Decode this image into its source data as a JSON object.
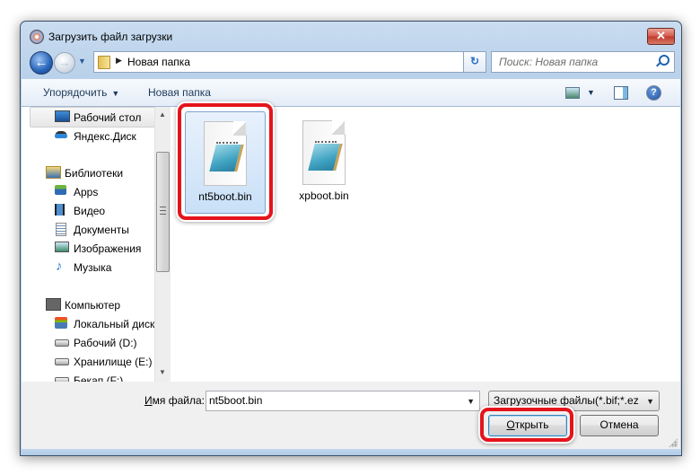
{
  "window": {
    "title": "Загрузить файл загрузки",
    "close_label": "✕"
  },
  "navigation": {
    "back_glyph": "←",
    "forward_glyph": "→",
    "breadcrumb": [
      "Новая папка"
    ],
    "refresh_glyph": "↻",
    "search_placeholder": "Поиск: Новая папка"
  },
  "toolbar": {
    "organize_label": "Упорядочить",
    "new_folder_label": "Новая папка",
    "help_glyph": "?"
  },
  "sidebar": {
    "items": [
      {
        "label": "Рабочий стол",
        "icon": "desktop-icon",
        "selected": true
      },
      {
        "label": "Яндекс.Диск",
        "icon": "yandex-disk-icon"
      },
      {
        "label": "Библиотеки",
        "icon": "libraries-icon",
        "group": true
      },
      {
        "label": "Apps",
        "icon": "apps-icon"
      },
      {
        "label": "Видео",
        "icon": "video-icon"
      },
      {
        "label": "Документы",
        "icon": "documents-icon"
      },
      {
        "label": "Изображения",
        "icon": "pictures-icon"
      },
      {
        "label": "Музыка",
        "icon": "music-icon"
      },
      {
        "label": "Компьютер",
        "icon": "computer-icon",
        "group": true
      },
      {
        "label": "Локальный диск",
        "icon": "system-drive-icon"
      },
      {
        "label": "Рабочий (D:)",
        "icon": "drive-icon"
      },
      {
        "label": "Хранилище (E:)",
        "icon": "drive-icon"
      },
      {
        "label": "Бекап (F:)",
        "icon": "drive-icon"
      }
    ]
  },
  "files": [
    {
      "name": "nt5boot.bin",
      "selected": true
    },
    {
      "name": "xpboot.bin",
      "selected": false
    }
  ],
  "footer": {
    "filename_label_underlined": "И",
    "filename_label_rest": "мя файла:",
    "filename_value": "nt5boot.bin",
    "filetype_value": "Загрузочные файлы(*.bif;*.ezb",
    "open_label_underlined": "О",
    "open_label_rest": "ткрыть",
    "cancel_label": "Отмена"
  },
  "colors": {
    "highlight": "#e4141c",
    "accent": "#1e395b"
  }
}
